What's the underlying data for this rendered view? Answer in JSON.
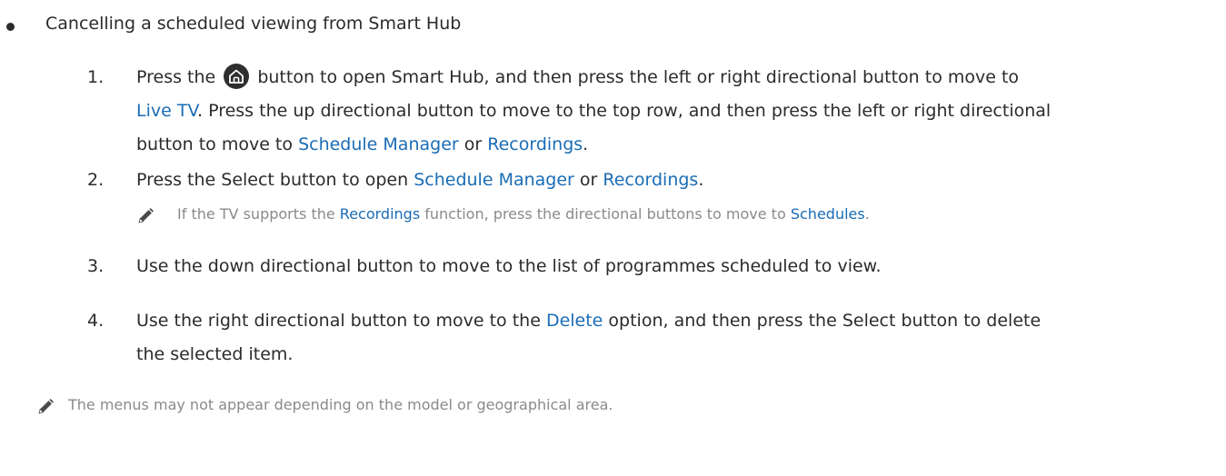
{
  "bullet": {
    "text": "Cancelling a scheduled viewing from Smart Hub"
  },
  "steps": [
    {
      "number": "1.",
      "line1_a": "Press the",
      "line1_b": "button to open Smart Hub, and then press the left or right directional button to move to",
      "line2_link": "Live TV",
      "line2_rest": ". Press the up directional button to move to the top row, and then press the left or right directional",
      "line3_a": "button to move to",
      "line3_link1": "Schedule Manager",
      "line3_or": "or",
      "line3_link2": "Recordings",
      "line3_end": "."
    },
    {
      "number": "2.",
      "a": "Press the Select button to open",
      "link1": "Schedule Manager",
      "or": "or",
      "link2": "Recordings",
      "end": "."
    },
    {
      "number": "3.",
      "text": "Use the down directional button to move to the list of programmes scheduled to view."
    },
    {
      "number": "4.",
      "line1_a": "Use the right directional button to move to the",
      "line1_link": "Delete",
      "line1_b": "option, and then press the Select button to delete",
      "line2": "the selected item."
    }
  ],
  "note1": {
    "a": "If the TV supports the",
    "link1": "Recordings",
    "b": "function, press the directional buttons to move to",
    "link2": "Schedules",
    "end": "."
  },
  "note2": {
    "text": "The menus may not appear depending on the model or geographical area."
  },
  "colors": {
    "link": "#1a6cb5",
    "text": "#2b2b2b",
    "note": "#8a8a8a"
  },
  "icons": {
    "home_button": "home-icon",
    "note": "pencil-icon"
  }
}
